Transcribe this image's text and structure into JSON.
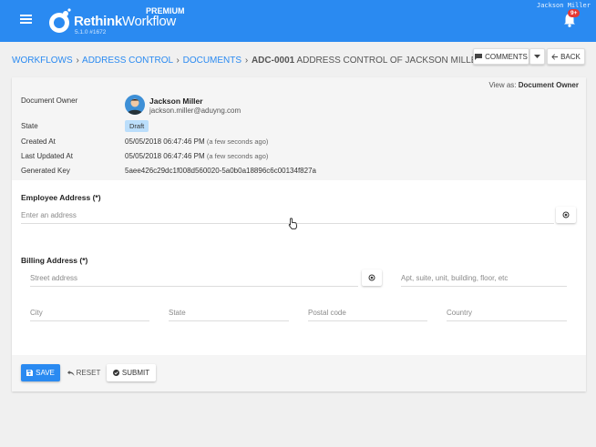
{
  "app": {
    "brand_bold": "Rethink",
    "brand_light": "Workflow",
    "version": "5.1.0 #1672",
    "tier": "PREMIUM",
    "user": "Jackson Miller",
    "notifications": "9+",
    "accent_color": "#2a8af1"
  },
  "breadcrumb": {
    "items": [
      "WORKFLOWS",
      "ADDRESS CONTROL",
      "DOCUMENTS"
    ],
    "separator": "›",
    "current_id": "ADC-0001",
    "current_title": "ADDRESS CONTROL OF JACKSON MILLER"
  },
  "toolbar": {
    "comments_label": "COMMENTS",
    "back_label": "BACK"
  },
  "document": {
    "view_as_label": "View as:",
    "view_as_value": "Document Owner",
    "owner_label": "Document Owner",
    "owner_name": "Jackson Miller",
    "owner_email": "jackson.miller@aduyng.com",
    "state_label": "State",
    "state_value": "Draft",
    "created_label": "Created At",
    "created_value": "05/05/2018 06:47:46 PM",
    "created_ago": "(a few seconds ago)",
    "updated_label": "Last Updated At",
    "updated_value": "05/05/2018 06:47:46 PM",
    "updated_ago": "(a few seconds ago)",
    "key_label": "Generated Key",
    "key_value": "5aee426c29dc1f008d560020-5a0b0a18896c6c00134f827a"
  },
  "form": {
    "employee_title": "Employee Address (*)",
    "employee_placeholder": "Enter an address",
    "billing_title": "Billing Address (*)",
    "street_placeholder": "Street address",
    "apt_placeholder": "Apt, suite, unit, building, floor, etc",
    "city_placeholder": "City",
    "state_placeholder": "State",
    "postal_placeholder": "Postal code",
    "country_placeholder": "Country"
  },
  "actions": {
    "save_label": "SAVE",
    "reset_label": "RESET",
    "submit_label": "SUBMIT"
  }
}
